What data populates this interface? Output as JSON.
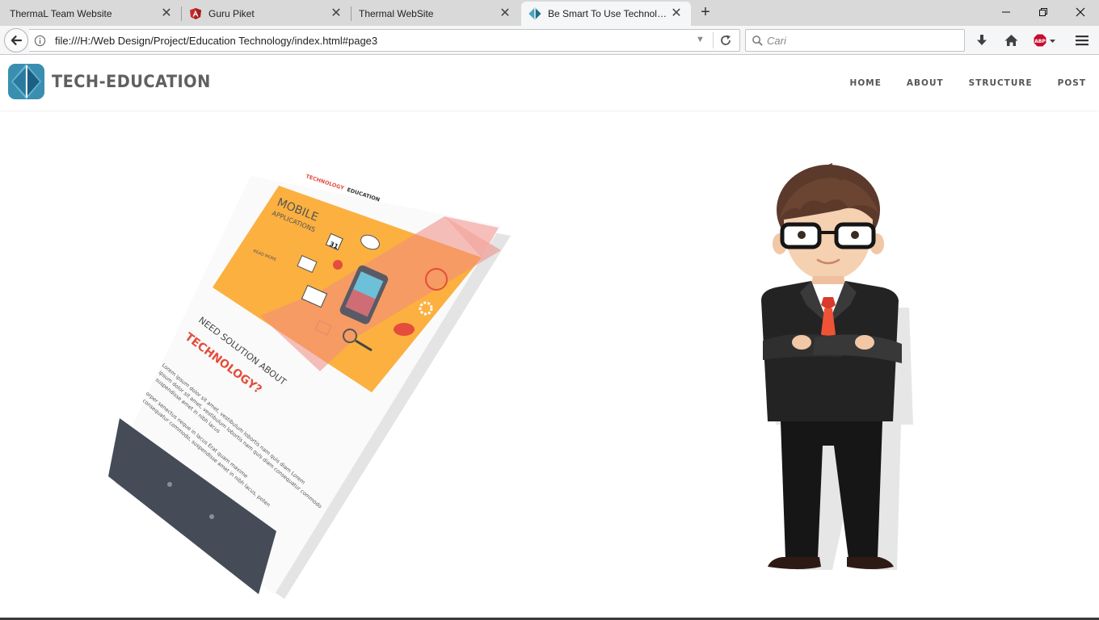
{
  "browser": {
    "tabs": [
      {
        "title": "ThermaL Team Website",
        "active": false
      },
      {
        "title": "Guru Piket",
        "active": false
      },
      {
        "title": "Thermal WebSite",
        "active": false
      },
      {
        "title": "Be Smart To Use Technolo...",
        "active": true
      }
    ],
    "new_tab": "+",
    "window_controls": {
      "minimize": "—",
      "restore": "❐",
      "close": "✕"
    },
    "url": "file:///H:/Web Design/Project/Education Technology/index.html#page3",
    "search_placeholder": "Cari",
    "toolbar_icons": [
      "download-icon",
      "home-icon",
      "adblock-icon",
      "menu-icon"
    ],
    "adblock_label": "ABP"
  },
  "site": {
    "brand": "TECH-EDUCATION",
    "menu": [
      {
        "label": "HOME"
      },
      {
        "label": "ABOUT"
      },
      {
        "label": "STRUCTURE"
      },
      {
        "label": "POST"
      }
    ],
    "colors": {
      "logo_dark": "#1f6e8c",
      "logo_light": "#4aa3c2",
      "brand_text": "#606060",
      "flyer_orange": "#fbb040",
      "flyer_red": "#e8413b",
      "flyer_footer": "#454b57"
    }
  },
  "flyer": {
    "kicker_red": "TECHNOLOGY",
    "kicker_dark": "EDUCATION",
    "title1": "MOBILE",
    "title2": "APPLICATIONS",
    "read_more": "READ MORE",
    "date": "31",
    "need": "NEED SOLUTION ABOUT",
    "headline": "TECHNOLOGY?",
    "body1": "Lorem ipsum dolor sit amet, vestibulum lobortis nam quis diam Lorem",
    "body2": "ipsum dolor sit amet, vestibulum lobortis nam quis diam consequatur commodo",
    "body3": "suspendisse amet in nibh lacus",
    "body4": "orper senectus neque in lacus Erat quam maxime",
    "body5": "consequatur commodo, suspendisse amet in nibh lacus, poten"
  }
}
